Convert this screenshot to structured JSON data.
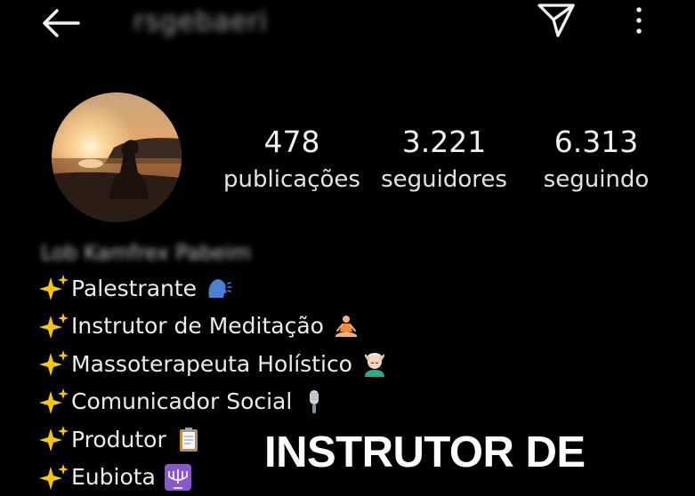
{
  "header": {
    "username": "rsgebaeri",
    "icons": {
      "back": "back-arrow-icon",
      "send": "paper-plane-icon",
      "more": "more-vertical-icon"
    }
  },
  "profile": {
    "avatar": "sunset-meditation-photo",
    "stats": [
      {
        "value": "478",
        "label": "publicações"
      },
      {
        "value": "3.221",
        "label": "seguidores"
      },
      {
        "value": "6.313",
        "label": "seguindo"
      }
    ],
    "full_name": "Lob Kamfrex Pabeim"
  },
  "bio": {
    "lines": [
      {
        "text": "Palestrante",
        "emoji": "speaking-head-icon"
      },
      {
        "text": "Instrutor de Meditação",
        "emoji": "meditating-person-icon"
      },
      {
        "text": "Massoterapeuta Holístico",
        "emoji": "face-massage-icon"
      },
      {
        "text": "Comunicador Social",
        "emoji": "microphone-icon"
      },
      {
        "text": "Produtor",
        "emoji": "clipboard-icon"
      },
      {
        "text": "Eubiota",
        "emoji": "menorah-icon"
      }
    ]
  },
  "overlay_caption": "INSTRUTOR DE",
  "colors": {
    "background": "#000000",
    "text": "#ececec",
    "sparkle": "#f5c518",
    "emoji_blue": "#4a7fd1"
  }
}
